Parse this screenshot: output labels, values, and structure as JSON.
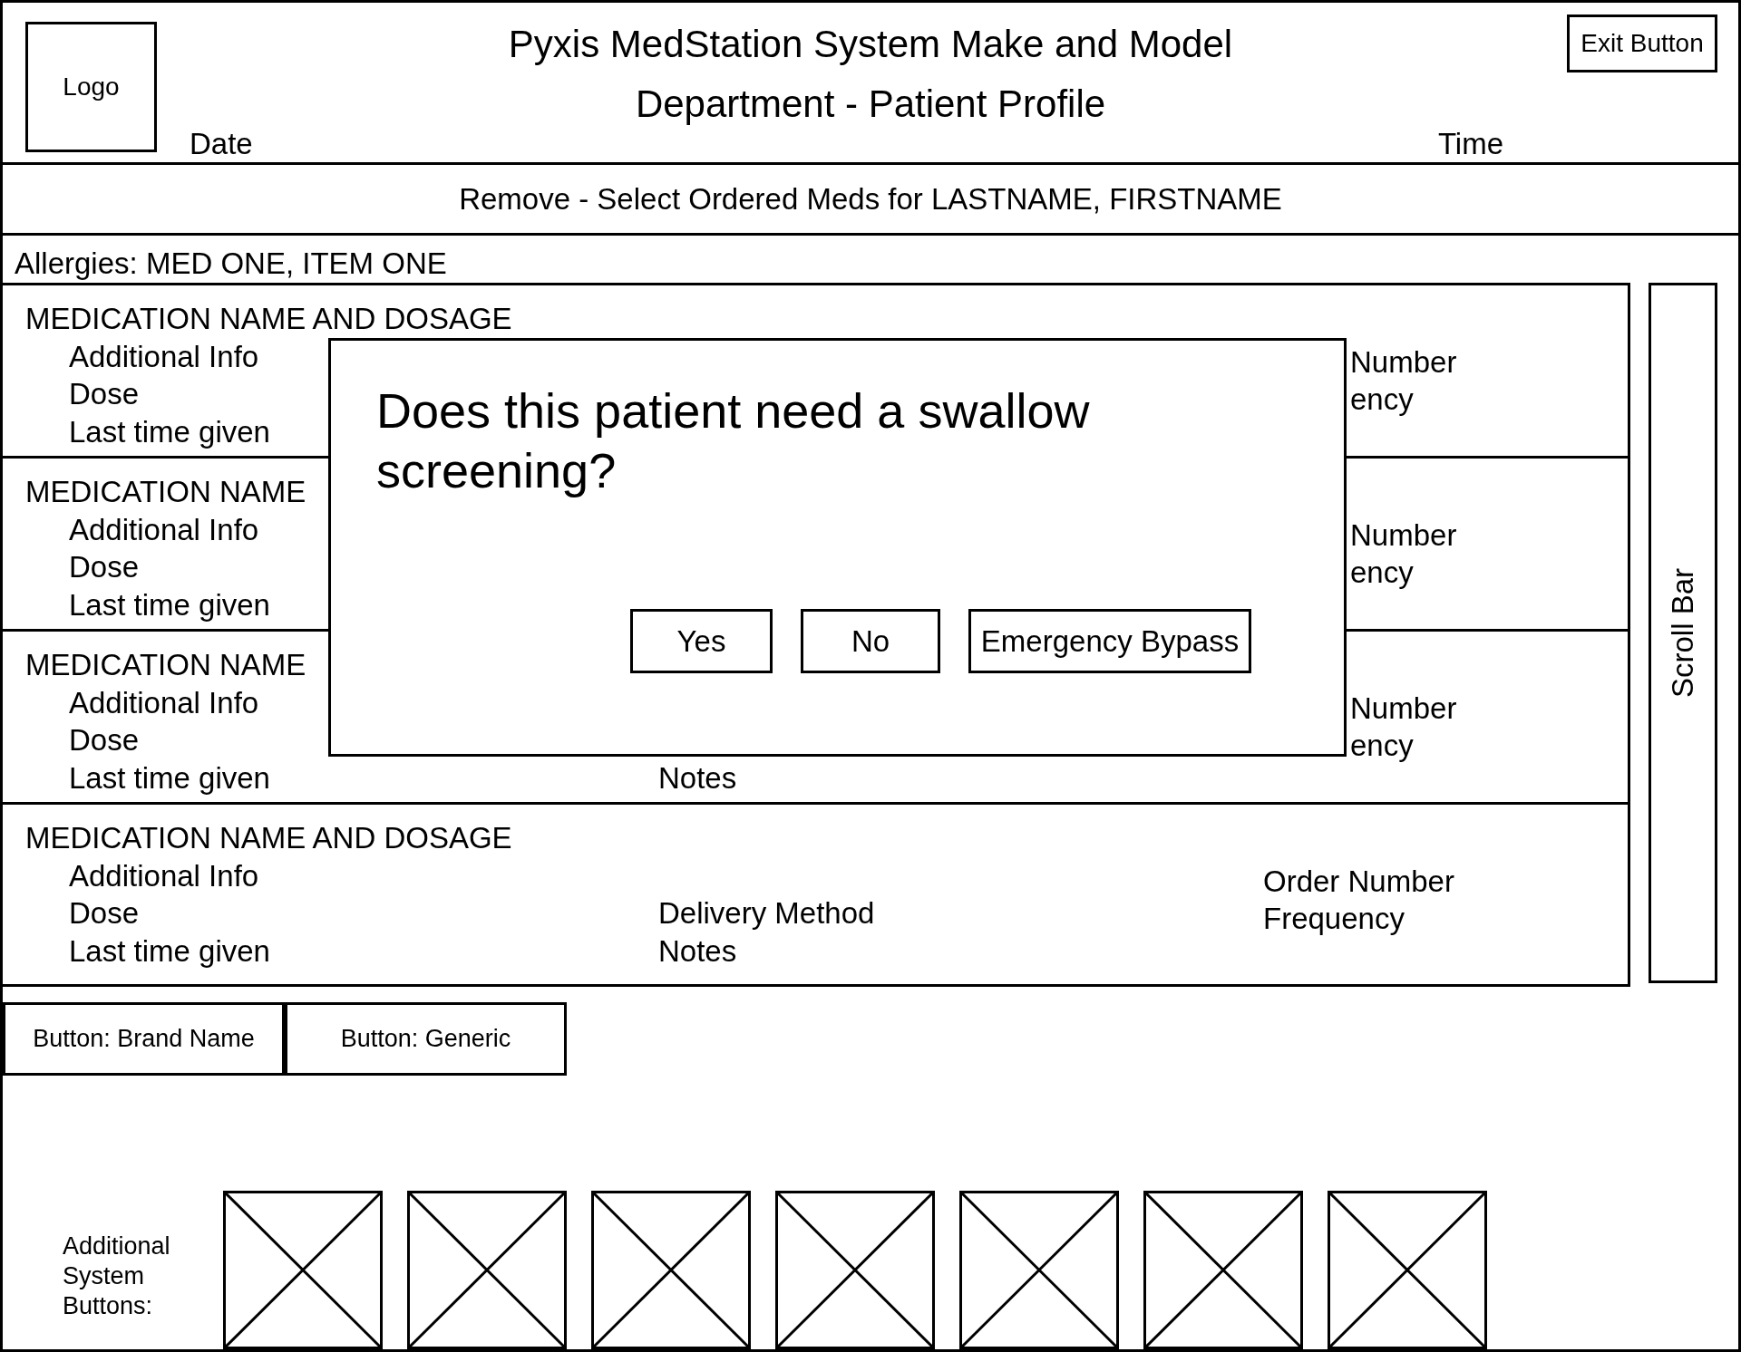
{
  "header": {
    "logo": "Logo",
    "title": "Pyxis MedStation System Make and Model",
    "subtitle": "Department - Patient Profile",
    "date": "Date",
    "time": "Time",
    "exit_button": "Exit Button"
  },
  "instruction": "Remove - Select Ordered Meds for LASTNAME, FIRSTNAME",
  "allergies": "Allergies: MED ONE, ITEM ONE",
  "medications": [
    {
      "name": "MEDICATION NAME AND DOSAGE",
      "additional_info": "Additional Info",
      "dose": "Dose",
      "last_given": "Last time given",
      "order_number": "Number",
      "frequency": "ency"
    },
    {
      "name": "MEDICATION NAME",
      "additional_info": "Additional Info",
      "dose": "Dose",
      "last_given": "Last time given",
      "order_number": "Number",
      "frequency": "ency"
    },
    {
      "name": "MEDICATION NAME",
      "additional_info": "Additional Info",
      "dose": "Dose",
      "last_given": "Last time given",
      "notes": "Notes",
      "order_number": "Number",
      "frequency": "ency"
    },
    {
      "name": "MEDICATION NAME AND DOSAGE",
      "additional_info": "Additional Info",
      "dose": "Dose",
      "last_given": "Last time given",
      "delivery_method": "Delivery Method",
      "notes": "Notes",
      "order_number": "Order Number",
      "frequency": "Frequency"
    }
  ],
  "scroll_bar": {
    "label": "Scroll Bar"
  },
  "name_buttons": [
    {
      "label": "Button: Brand Name"
    },
    {
      "label": "Button: Generic"
    }
  ],
  "system_buttons": {
    "label": "Additional System Buttons:",
    "items": [
      {
        "kind": "placeholder"
      },
      {
        "kind": "placeholder"
      },
      {
        "kind": "placeholder"
      },
      {
        "kind": "placeholder"
      },
      {
        "kind": "placeholder"
      },
      {
        "kind": "placeholder"
      },
      {
        "kind": "placeholder"
      }
    ]
  },
  "dialog": {
    "question": "Does this patient need a swallow screening?",
    "buttons": [
      {
        "label": "Yes"
      },
      {
        "label": "No"
      },
      {
        "label": "Emergency Bypass"
      }
    ]
  }
}
